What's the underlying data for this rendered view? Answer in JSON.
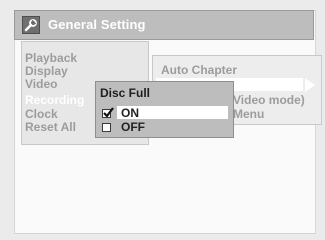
{
  "header": {
    "title": "General Setting",
    "icon": "wrench-icon"
  },
  "submenu": {
    "items": [
      "Playback",
      "Display",
      "Video",
      "Recording",
      "Clock",
      "Reset All"
    ],
    "selected": "Recording"
  },
  "right_menu": {
    "items": [
      "Auto Chapter",
      "",
      "Video mode)",
      "Menu"
    ]
  },
  "dialog": {
    "title": "Disc Full",
    "options": [
      "ON",
      "OFF"
    ],
    "selected": "ON"
  },
  "colors": {
    "title_bar": "#bdbdbd",
    "panel_bg": "#fafafa",
    "muted_text": "#9c9c9c",
    "active_text": "#ffffff",
    "dialog_bg": "#bdbdbd"
  }
}
